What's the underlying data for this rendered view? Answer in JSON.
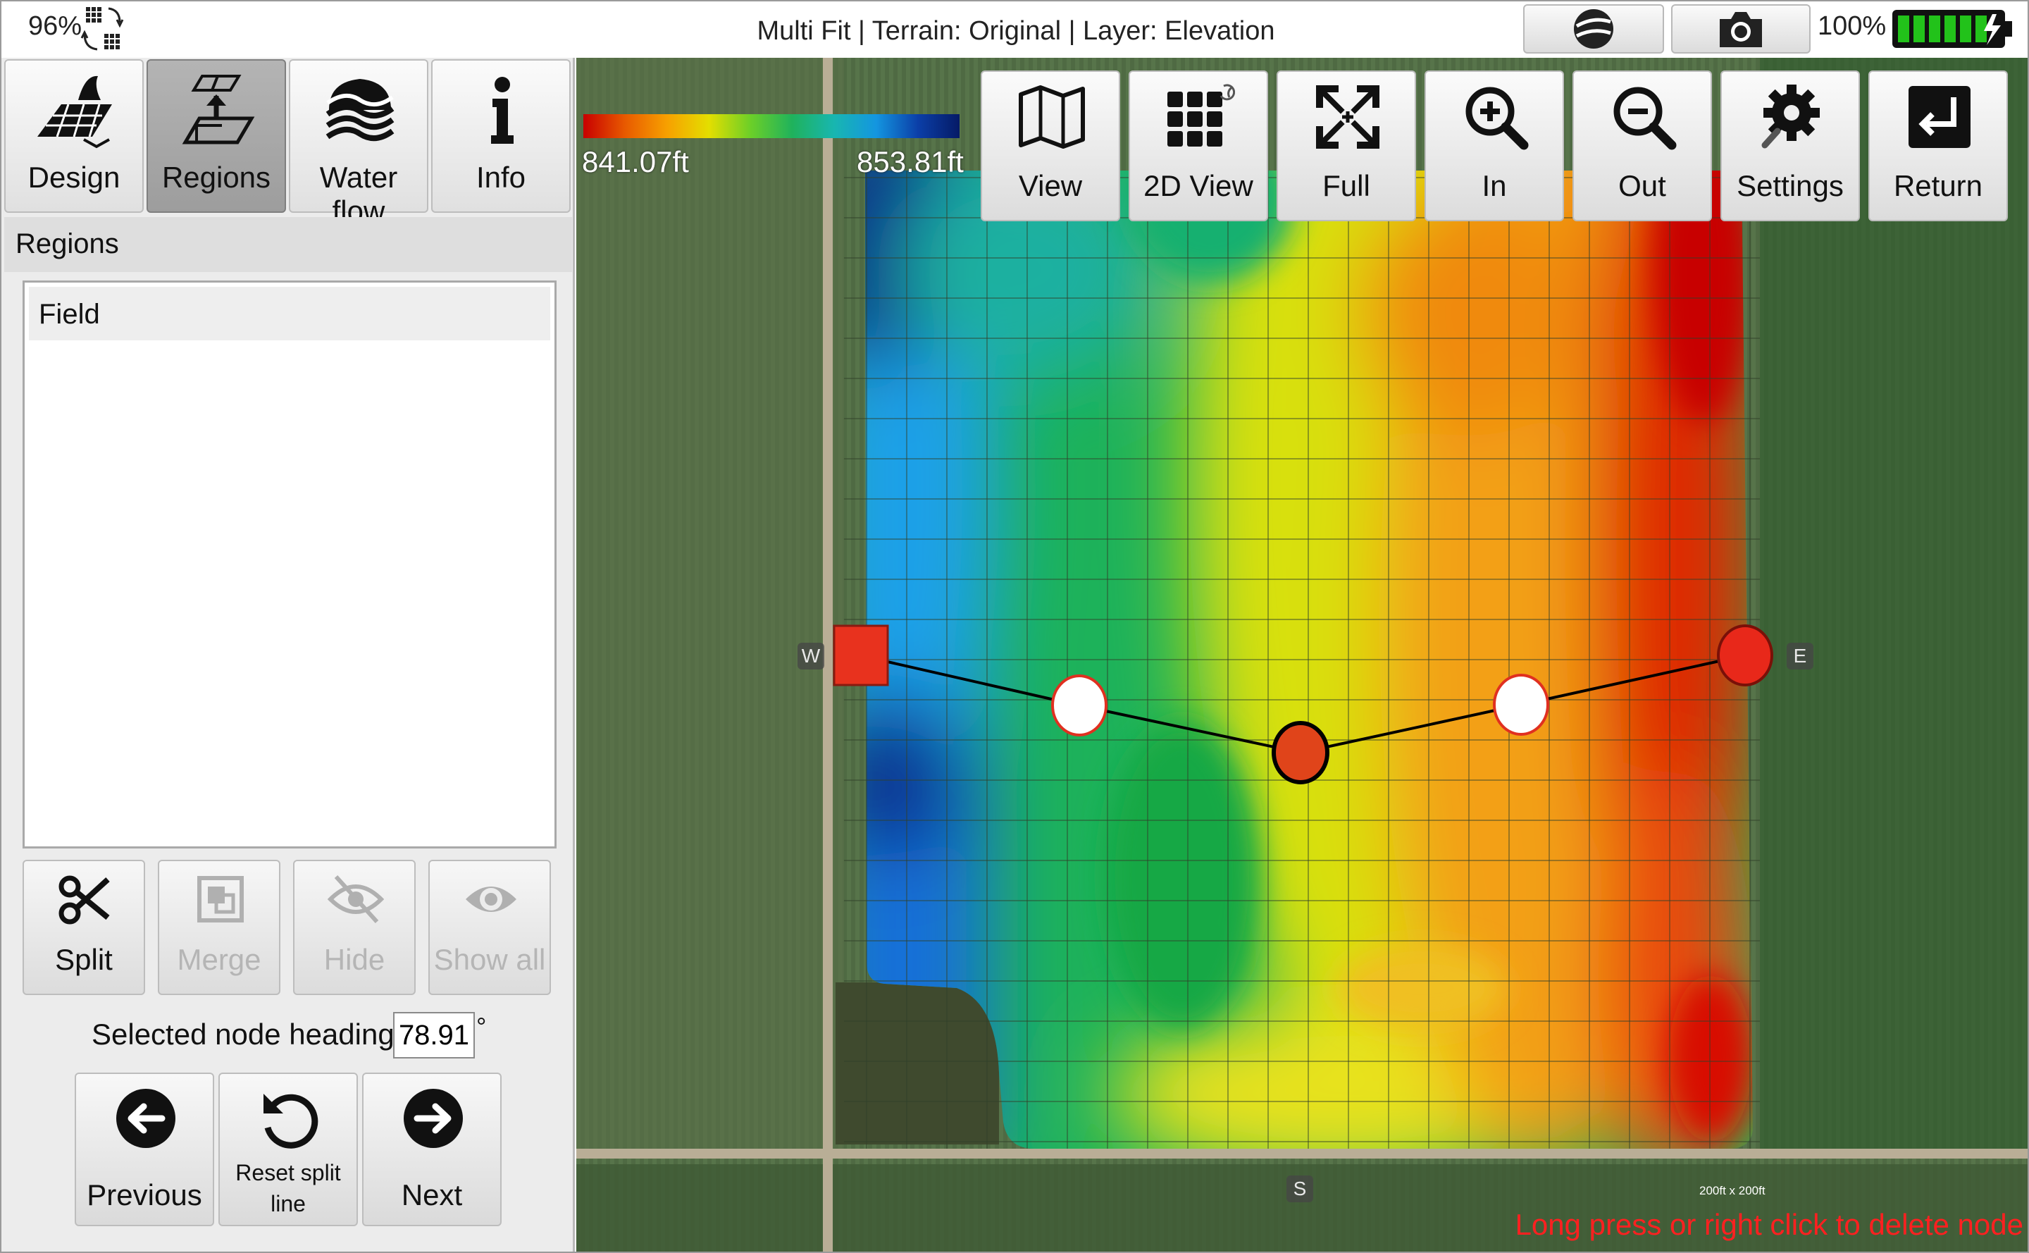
{
  "titlebar": {
    "title": "Multi Fit | Terrain: Original | Layer: Elevation",
    "signal_percent": "96%",
    "battery_percent": "100%",
    "battery_level": 1.0,
    "globe_icon": "globe-icon",
    "camera_icon": "camera-icon"
  },
  "mode_tabs": [
    {
      "label": "Design",
      "icon": "design-icon",
      "active": false
    },
    {
      "label": "Regions",
      "icon": "regions-icon",
      "active": true
    },
    {
      "label": "Water flow",
      "icon": "water-flow-icon",
      "active": false
    },
    {
      "label": "Info",
      "icon": "info-icon",
      "active": false
    }
  ],
  "regions": {
    "header": "Regions",
    "items": [
      "Field"
    ]
  },
  "tools": [
    {
      "label": "Split",
      "icon": "scissors-icon",
      "enabled": true
    },
    {
      "label": "Merge",
      "icon": "merge-icon",
      "enabled": false
    },
    {
      "label": "Hide",
      "icon": "hide-eye-icon",
      "enabled": false
    },
    {
      "label": "Show all",
      "icon": "eye-icon",
      "enabled": false
    }
  ],
  "heading": {
    "label": "Selected node heading:",
    "value": "78.91",
    "unit": "°"
  },
  "nav": {
    "previous": "Previous",
    "reset": "Reset split line",
    "next": "Next"
  },
  "map": {
    "legend_min": "841.07ft",
    "legend_max": "853.81ft",
    "buttons": [
      {
        "label": "View",
        "icon": "map-view-icon"
      },
      {
        "label": "2D View",
        "icon": "grid-2d-icon"
      },
      {
        "label": "Full",
        "icon": "full-extent-icon"
      },
      {
        "label": "In",
        "icon": "zoom-in-icon"
      },
      {
        "label": "Out",
        "icon": "zoom-out-icon"
      },
      {
        "label": "Settings",
        "icon": "settings-gear-icon"
      },
      {
        "label": "Return",
        "icon": "return-icon"
      }
    ],
    "compass": {
      "west": "W",
      "east": "E",
      "south": "S"
    },
    "scale": "200ft x 200ft",
    "hint": "Long press or right click to delete node",
    "colors": {
      "low": "#c80000",
      "mid": "#e4de00",
      "high": "#051a66",
      "node_red": "#e8321e",
      "node_selected": "#e0441a"
    }
  }
}
